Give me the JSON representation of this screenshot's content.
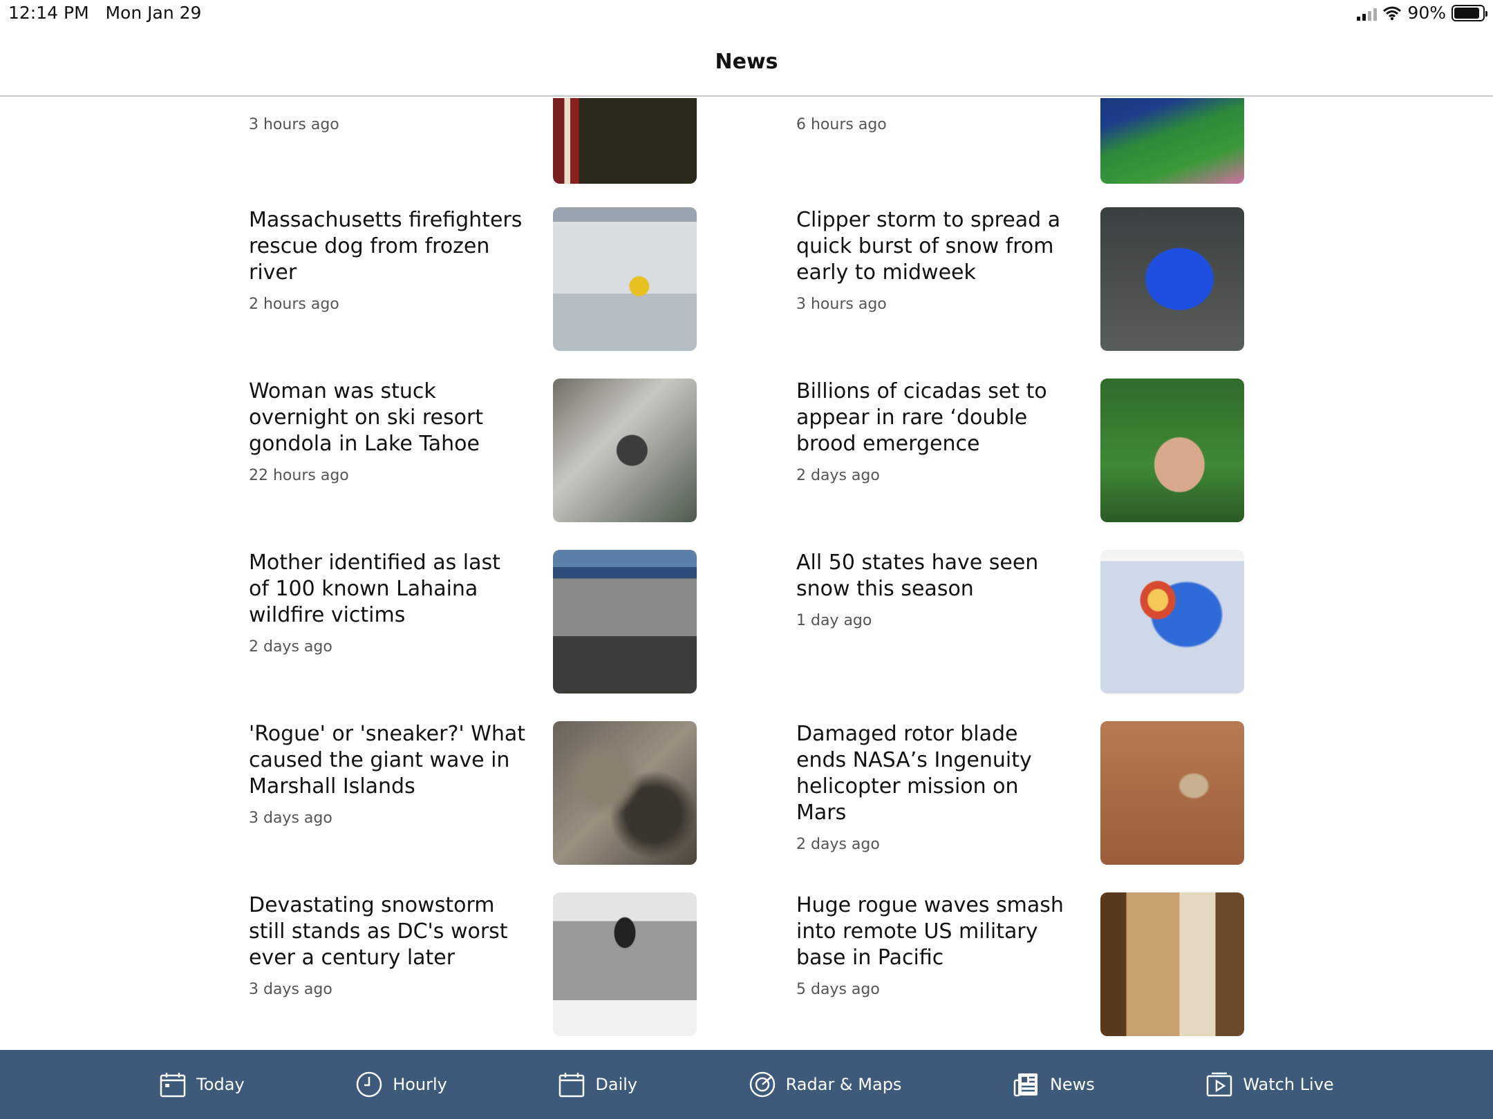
{
  "status_bar": {
    "time": "12:14 PM",
    "date": "Mon Jan 29",
    "battery_percent": "90%",
    "battery_level": 0.9
  },
  "header": {
    "title": "News"
  },
  "articles": {
    "left": [
      {
        "headline": "",
        "time": "3 hours ago",
        "image": "flag-person-photo"
      },
      {
        "headline": "Massachusetts firefighters rescue dog from frozen river",
        "time": "2 hours ago",
        "image": "frozen-river-rescue-photo"
      },
      {
        "headline": "Woman was stuck overnight on ski resort gondola in Lake Tahoe",
        "time": "22 hours ago",
        "image": "gondola-photo"
      },
      {
        "headline": "Mother identified as last of 100 known Lahaina wildfire victims",
        "time": "2 days ago",
        "image": "lahaina-aerial-photo"
      },
      {
        "headline": "'Rogue' or 'sneaker?' What caused the giant wave in Marshall Islands",
        "time": "3 days ago",
        "image": "wave-closeup-photo"
      },
      {
        "headline": "Devastating snowstorm still stands as DC's worst ever a century later",
        "time": "3 days ago",
        "image": "knickerbocker-theatre-photo"
      }
    ],
    "right": [
      {
        "headline": "",
        "time": "6 hours ago",
        "image": "west-coast-map"
      },
      {
        "headline": "Clipper storm to spread a quick burst of snow from early to midweek",
        "time": "3 hours ago",
        "image": "clipper-snow-map"
      },
      {
        "headline": "Billions of cicadas set to appear in rare ‘double brood emergence",
        "time": "2 days ago",
        "image": "cicada-on-arm-photo"
      },
      {
        "headline": "All 50 states have seen snow this season",
        "time": "1 day ago",
        "image": "snowfall-analysis-map"
      },
      {
        "headline": "Damaged rotor blade ends NASA’s Ingenuity helicopter mission on Mars",
        "time": "2 days ago",
        "image": "mars-helicopter-photo"
      },
      {
        "headline": "Huge rogue waves smash into remote US military base in Pacific",
        "time": "5 days ago",
        "image": "wave-through-door-photo"
      }
    ]
  },
  "tabbar": {
    "items": [
      {
        "label": "Today",
        "icon": "calendar-icon"
      },
      {
        "label": "Hourly",
        "icon": "clock-icon"
      },
      {
        "label": "Daily",
        "icon": "calendar-icon"
      },
      {
        "label": "Radar & Maps",
        "icon": "radar-icon"
      },
      {
        "label": "News",
        "icon": "newspaper-icon",
        "active": true
      },
      {
        "label": "Watch Live",
        "icon": "play-icon"
      }
    ],
    "color": "#3e5a7a"
  }
}
